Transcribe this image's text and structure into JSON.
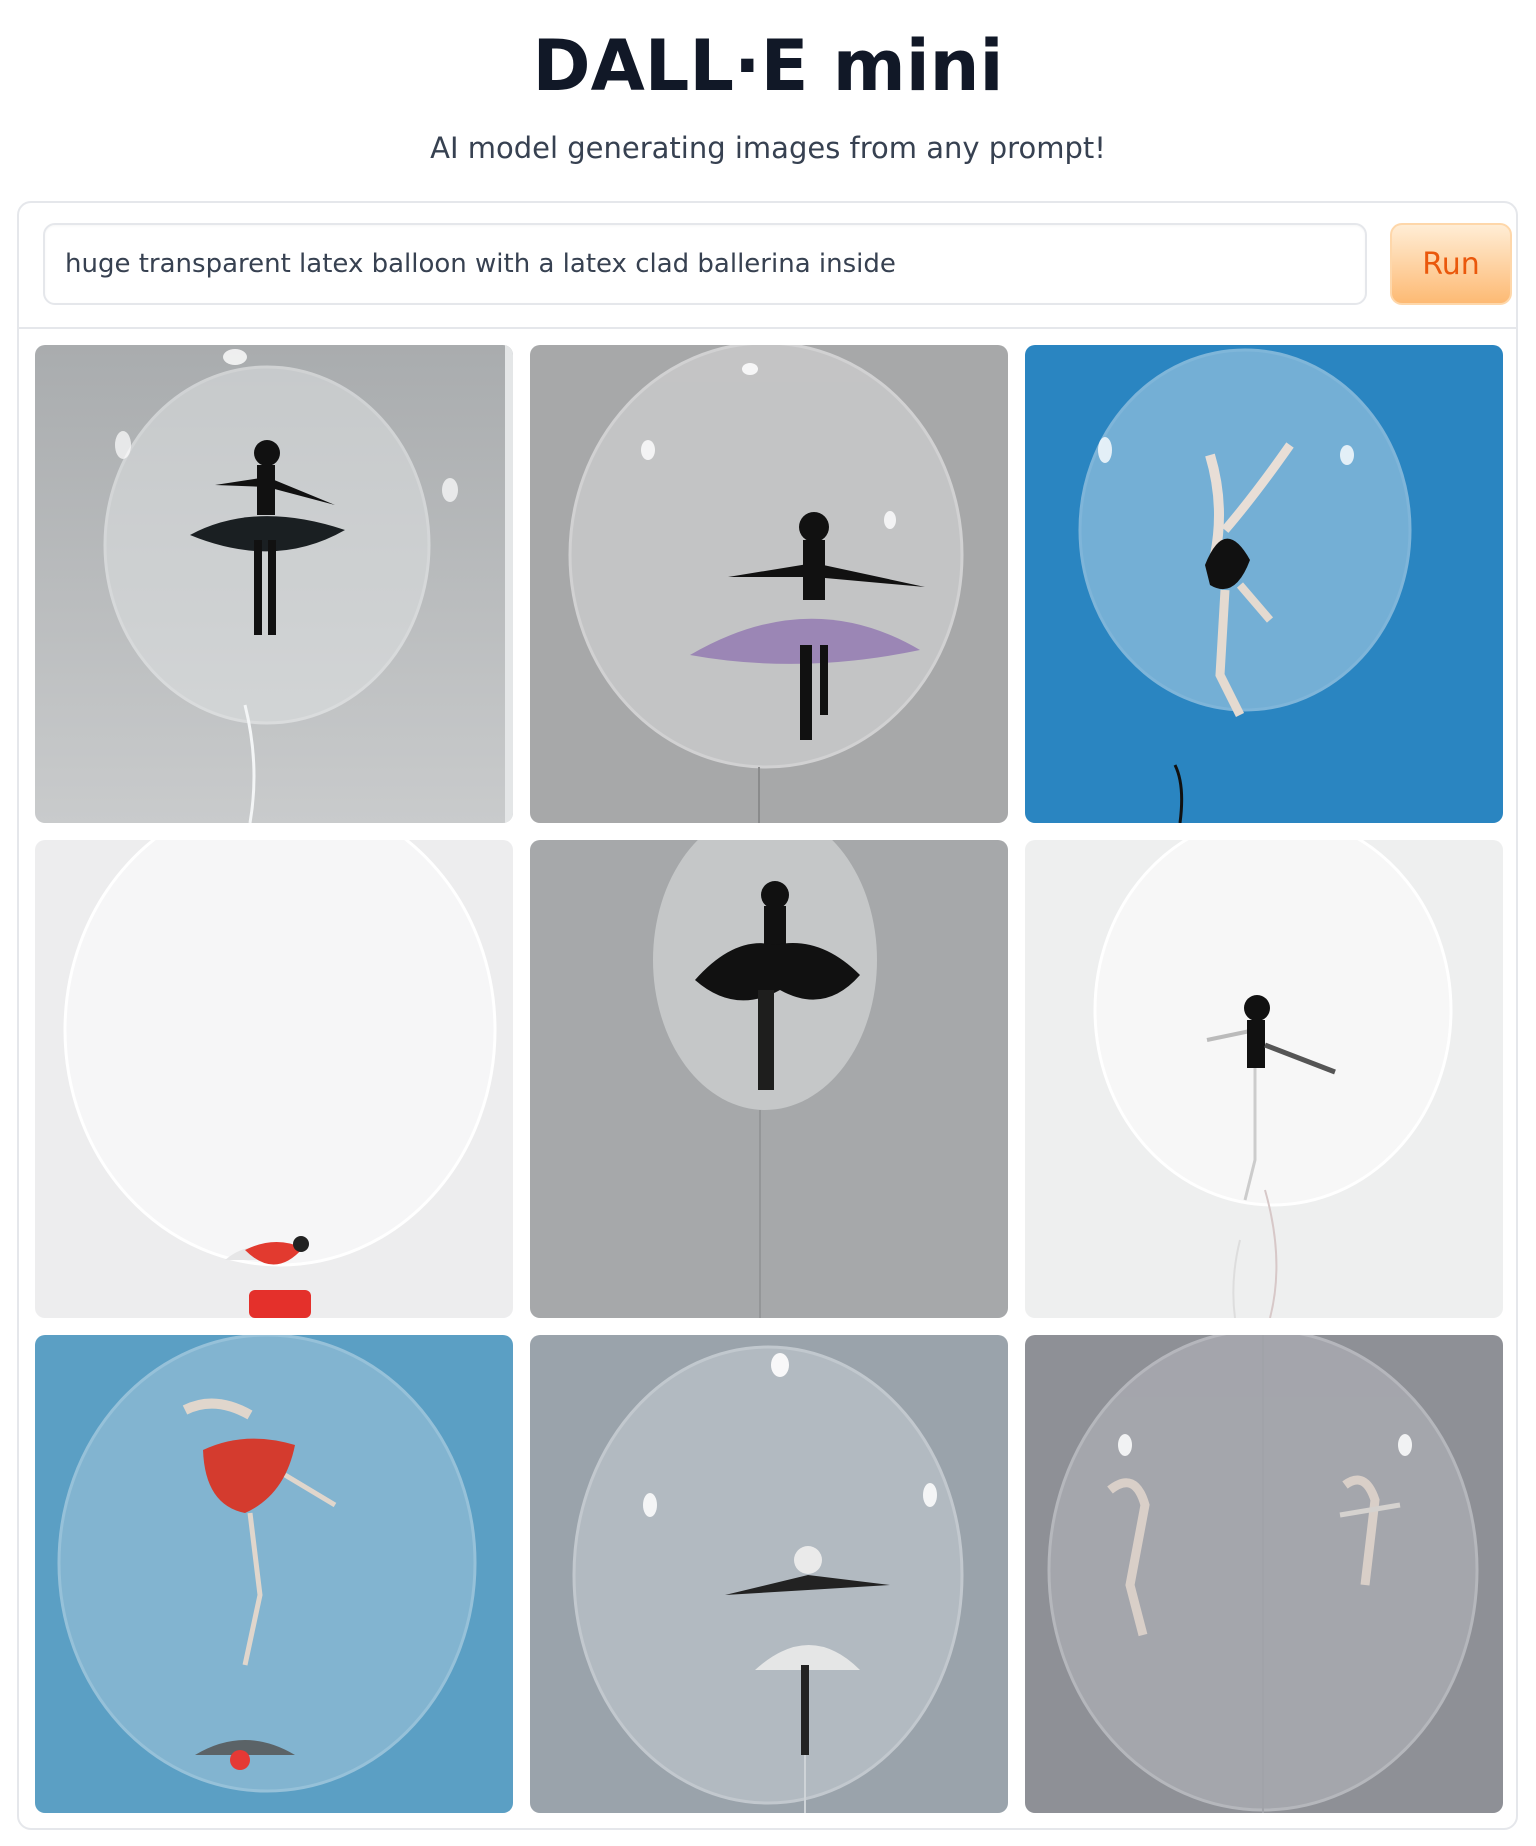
{
  "app": {
    "title": "DALL·E mini",
    "subtitle": "AI model generating images from any prompt!"
  },
  "prompt": {
    "value": "huge transparent latex balloon with a latex clad ballerina inside"
  },
  "run_button": {
    "label": "Run"
  },
  "colors": {
    "accent": "#ea580c",
    "button_bg": "#fed7aa",
    "border": "#e5e7eb"
  },
  "gallery": {
    "images": [
      {
        "subject": "ballerina in transparent balloon",
        "background": "gray",
        "figure": "black silhouette with black tutu"
      },
      {
        "subject": "ballerina in transparent balloon",
        "background": "gray",
        "figure": "black silhouette with purple tutu"
      },
      {
        "subject": "ballerina in transparent balloon",
        "background": "blue sky",
        "figure": "pale dancer leaping"
      },
      {
        "subject": "ballerina in transparent balloon",
        "background": "white",
        "figure": "small red ballerina at balloon neck"
      },
      {
        "subject": "ballerina in transparent balloon",
        "background": "gray",
        "figure": "black figure arms arched"
      },
      {
        "subject": "ballerina in transparent balloon",
        "background": "white",
        "figure": "black dancer with raised leg"
      },
      {
        "subject": "ballerina in transparent balloon",
        "background": "blue",
        "figure": "dancer in red tutu"
      },
      {
        "subject": "ballerina in transparent balloon",
        "background": "gray blue",
        "figure": "dancer in white tutu"
      },
      {
        "subject": "ballerina in transparent balloon",
        "background": "gray",
        "figure": "two pale figures"
      }
    ]
  }
}
